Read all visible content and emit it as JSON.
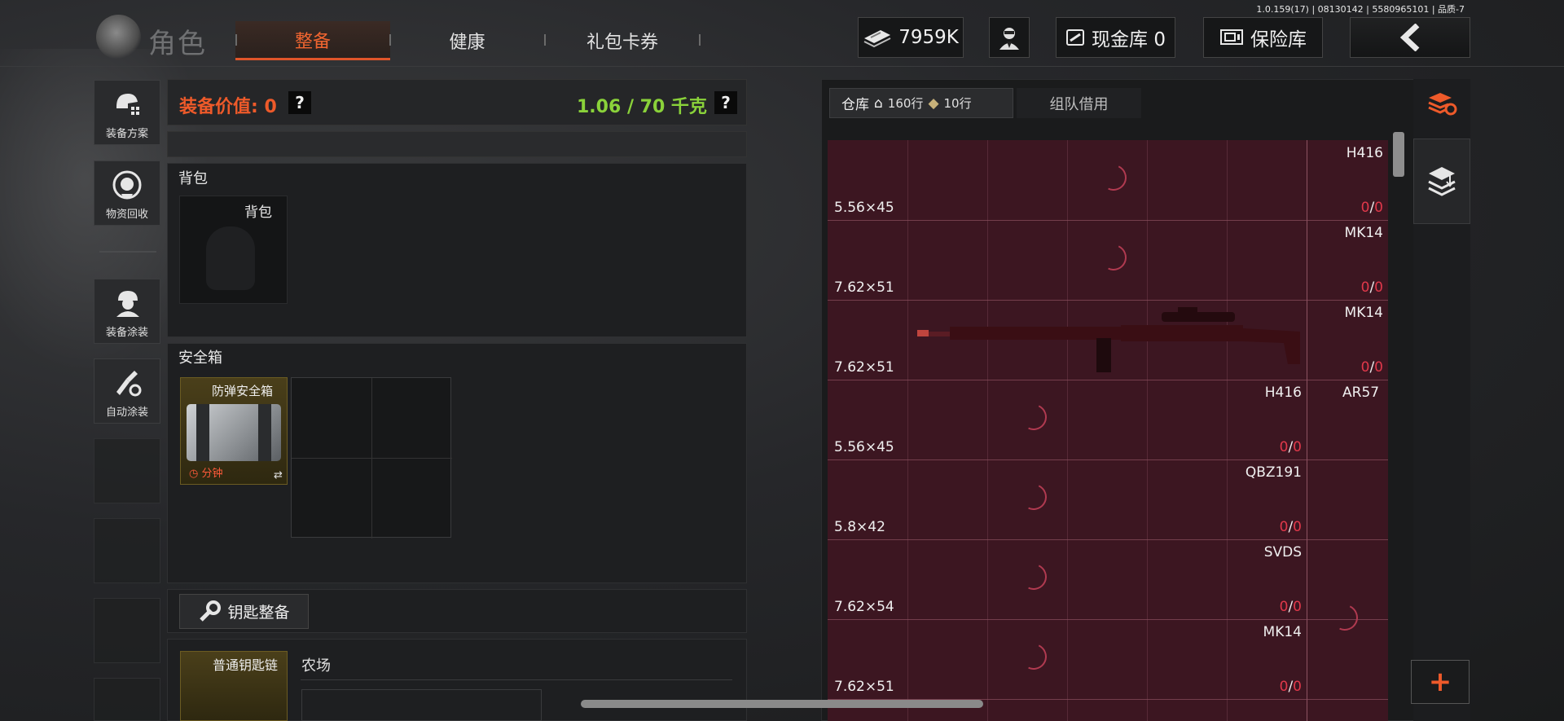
{
  "version": "1.0.159(17) | 08130142 | 5580965101 | 品质-7",
  "header": {
    "role_label": "角色",
    "tabs": [
      "整备",
      "健康",
      "礼包卡券"
    ],
    "money": "7959K",
    "cash_vault": "现金库 0",
    "insurance": "保险库"
  },
  "left_nav": [
    {
      "label": "装备方案",
      "icon": "helmet-grid-icon"
    },
    {
      "label": "物资回收",
      "icon": "recycle-icon"
    },
    {
      "label": "装备涂装",
      "icon": "soldier-icon"
    },
    {
      "label": "自动涂装",
      "icon": "brush-gear-icon"
    }
  ],
  "loadout": {
    "equip_value": "装备价值: 0",
    "help": "?",
    "weight": "1.06 / 70 千克",
    "backpack_title": "背包",
    "backpack_slot_label": "背包",
    "safe_title": "安全箱",
    "safe_item_name": "防弹安全箱",
    "safe_time": "分钟",
    "key_button": "钥匙整备",
    "key_chain_name": "普通钥匙链",
    "key_chain_location": "农场"
  },
  "warehouse": {
    "tab_label": "仓库",
    "rows_count": "160行",
    "extra_count": "10行",
    "team_tab": "组队借用",
    "items": [
      {
        "name": "H416",
        "caliber": "5.56×45",
        "ammo_have": "0",
        "ammo_total": "0"
      },
      {
        "name": "MK14",
        "caliber": "7.62×51",
        "ammo_have": "0",
        "ammo_total": "0"
      },
      {
        "name": "MK14",
        "caliber": "7.62×51",
        "ammo_have": "0",
        "ammo_total": "0"
      },
      {
        "name": "H416",
        "caliber": "5.56×45",
        "ammo_have": "0",
        "ammo_total": "0"
      },
      {
        "name": "QBZ191",
        "caliber": "5.8×42",
        "ammo_have": "0",
        "ammo_total": "0"
      },
      {
        "name": "SVDS",
        "caliber": "7.62×54",
        "ammo_have": "0",
        "ammo_total": "0"
      },
      {
        "name": "MK14",
        "caliber": "7.62×51",
        "ammo_have": "0",
        "ammo_total": "0"
      }
    ],
    "side_item": "AR57",
    "plus": "+"
  }
}
